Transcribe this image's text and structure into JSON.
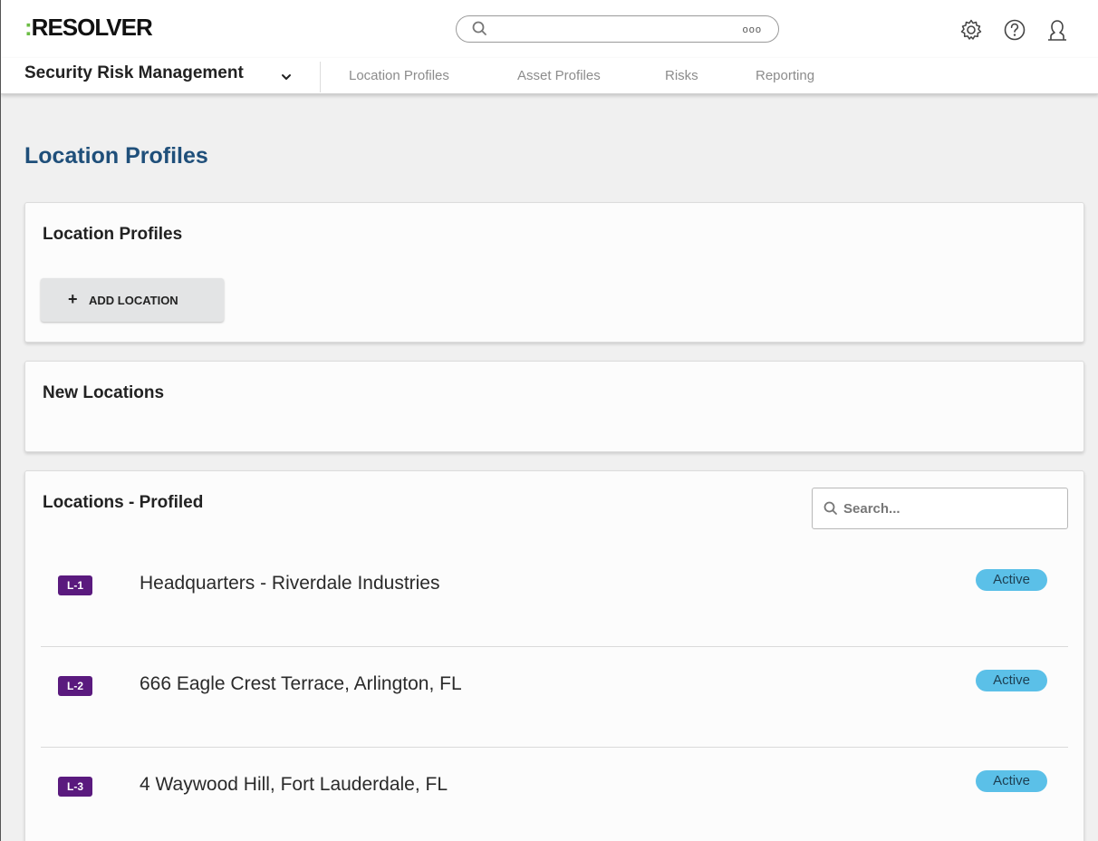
{
  "header": {
    "logo_mark": ":",
    "logo_text": "RESOLVER",
    "search_dots": "ooo"
  },
  "nav": {
    "app_name": "Security Risk Management",
    "tabs": [
      "Location Profiles",
      "Asset Profiles",
      "Risks",
      "Reporting"
    ]
  },
  "page": {
    "title": "Location Profiles"
  },
  "cards": {
    "location_profiles": {
      "title": "Location Profiles",
      "add_button_icon": "+",
      "add_button_label": "ADD LOCATION"
    },
    "new_locations": {
      "title": "New Locations"
    },
    "profiled": {
      "title": "Locations - Profiled",
      "search_placeholder": "Search...",
      "rows": [
        {
          "id": "L-1",
          "name": "Headquarters - Riverdale Industries",
          "status": "Active"
        },
        {
          "id": "L-2",
          "name": "666 Eagle Crest Terrace, Arlington, FL",
          "status": "Active"
        },
        {
          "id": "L-3",
          "name": "4 Waywood Hill, Fort Lauderdale, FL",
          "status": "Active"
        }
      ]
    }
  },
  "icons": {
    "search": "search-icon",
    "settings": "gear-icon",
    "help": "help-icon",
    "user": "user-icon",
    "app_select": "chevron-down-icon"
  },
  "colors": {
    "brand_green": "#6cbd45",
    "title_blue": "#1f4f7a",
    "badge_purple": "#5a1a7e",
    "status_blue": "#5bc0e8"
  }
}
